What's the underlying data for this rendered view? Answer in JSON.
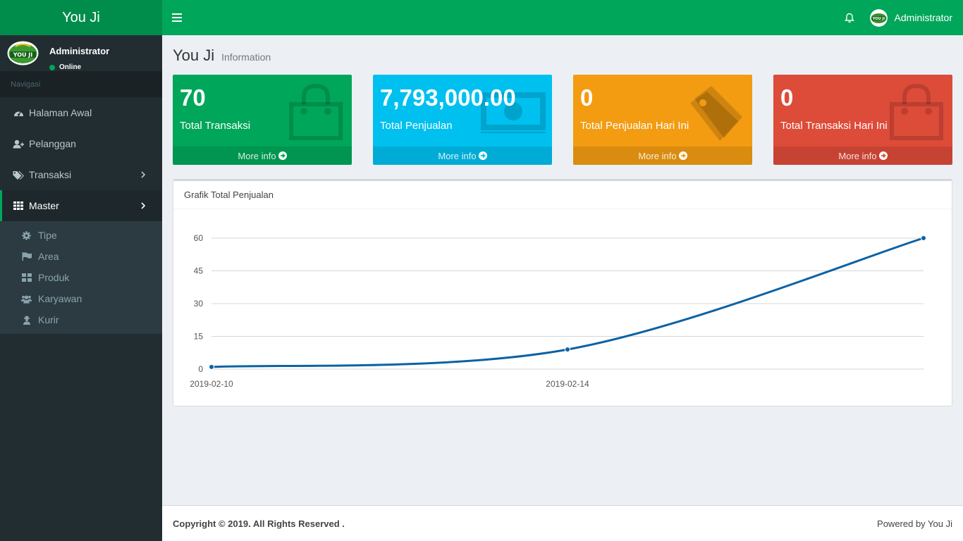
{
  "app": {
    "title": "You Ji"
  },
  "header": {
    "user_name": "Administrator"
  },
  "sidebar": {
    "user_name": "Administrator",
    "status": "Online",
    "nav_header": "Navigasi",
    "items": [
      {
        "label": "Halaman Awal",
        "icon": "dashboard-icon"
      },
      {
        "label": "Pelanggan",
        "icon": "user-plus-icon"
      },
      {
        "label": "Transaksi",
        "icon": "tags-icon"
      },
      {
        "label": "Master",
        "icon": "grid-icon"
      }
    ],
    "submenu": [
      {
        "label": "Tipe",
        "icon": "gear-icon"
      },
      {
        "label": "Area",
        "icon": "flag-icon"
      },
      {
        "label": "Produk",
        "icon": "th-large-icon"
      },
      {
        "label": "Karyawan",
        "icon": "users-icon"
      },
      {
        "label": "Kurir",
        "icon": "courier-icon"
      }
    ]
  },
  "page": {
    "title": "You Ji",
    "subtitle": "Information"
  },
  "stats": [
    {
      "value": "70",
      "label": "Total Transaksi",
      "more": "More info",
      "color": "#00a65a",
      "icon": "shopping-bag-icon"
    },
    {
      "value": "7,793,000.00",
      "label": "Total Penjualan",
      "more": "More info",
      "color": "#00c0ef",
      "icon": "money-icon"
    },
    {
      "value": "0",
      "label": "Total Penjualan Hari Ini",
      "more": "More info",
      "color": "#f39c12",
      "icon": "tags-icon"
    },
    {
      "value": "0",
      "label": "Total Transaksi Hari Ini",
      "more": "More info",
      "color": "#dd4b39",
      "icon": "shopping-bag-icon"
    }
  ],
  "chart_box": {
    "title": "Grafik Total Penjualan"
  },
  "chart_data": {
    "type": "line",
    "x": [
      "2019-02-10",
      "2019-02-14",
      "2019-02-18"
    ],
    "x_tick_labels": [
      "2019-02-10",
      "2019-02-14"
    ],
    "y_ticks": [
      0,
      15,
      30,
      45,
      60
    ],
    "ylim": [
      0,
      60
    ],
    "series": [
      {
        "values": [
          1,
          9,
          60
        ],
        "color": "#0b62a4"
      }
    ],
    "grid": true
  },
  "footer": {
    "copyright": "Copyright © 2019. All Rights Reserved .",
    "powered": "Powered by You Ji"
  }
}
